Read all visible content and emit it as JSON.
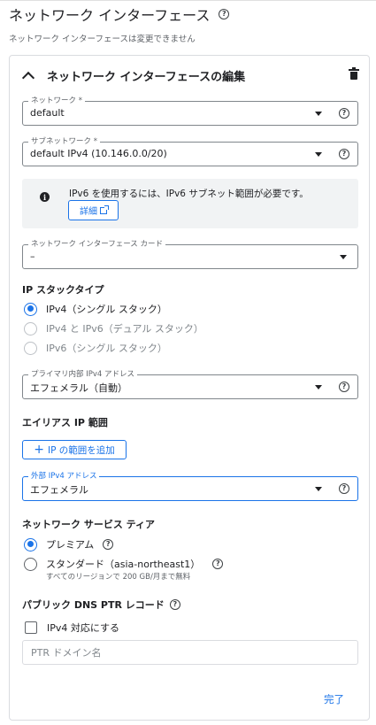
{
  "header": {
    "title": "ネットワーク インターフェース",
    "subtitle": "ネットワーク インターフェースは変更できません"
  },
  "card": {
    "title": "ネットワーク インターフェースの編集",
    "network": {
      "label": "ネットワーク *",
      "value": "default"
    },
    "subnetwork": {
      "label": "サブネットワーク *",
      "value": "default IPv4 (10.146.0.0/20)"
    },
    "info": {
      "text": "IPv6 を使用するには、IPv6 サブネット範囲が必要です。",
      "button_label": "詳細"
    },
    "nic_card": {
      "label": "ネットワーク インターフェース カード",
      "value": "–"
    },
    "ip_stack": {
      "label": "IP スタックタイプ",
      "options": [
        {
          "label": "IPv4（シングル スタック）",
          "checked": true,
          "disabled": false
        },
        {
          "label": "IPv4 と IPv6（デュアル スタック）",
          "checked": false,
          "disabled": true
        },
        {
          "label": "IPv6（シングル スタック）",
          "checked": false,
          "disabled": true
        }
      ]
    },
    "primary_internal_ipv4": {
      "label": "プライマリ内部 IPv4 アドレス",
      "value": "エフェメラル（自動）"
    },
    "alias_ip": {
      "label": "エイリアス IP 範囲",
      "button_label": "IP の範囲を追加"
    },
    "external_ipv4": {
      "label": "外部 IPv4 アドレス",
      "value": "エフェメラル"
    },
    "service_tier": {
      "label": "ネットワーク サービス ティア",
      "options": [
        {
          "label": "プレミアム",
          "checked": true
        },
        {
          "label": "スタンダード（asia-northeast1）",
          "checked": false,
          "sub": "すべてのリージョンで 200 GB/月まで無料"
        }
      ]
    },
    "dns_ptr": {
      "label": "パブリック DNS PTR レコード",
      "checkbox_label": "IPv4 対応にする",
      "checked": false,
      "placeholder": "PTR ドメイン名"
    },
    "done_label": "完了"
  },
  "icons": {
    "help": "help-circle-icon",
    "caret": "dropdown-caret-icon",
    "info": "info-icon",
    "delete": "trash-icon",
    "external": "open-in-new-icon",
    "collapse": "chevron-up-icon",
    "add": "plus-icon"
  },
  "colors": {
    "accent": "#1a73e8",
    "text": "#202124",
    "muted": "#5f6368",
    "info_bg": "#f1f3f4"
  }
}
